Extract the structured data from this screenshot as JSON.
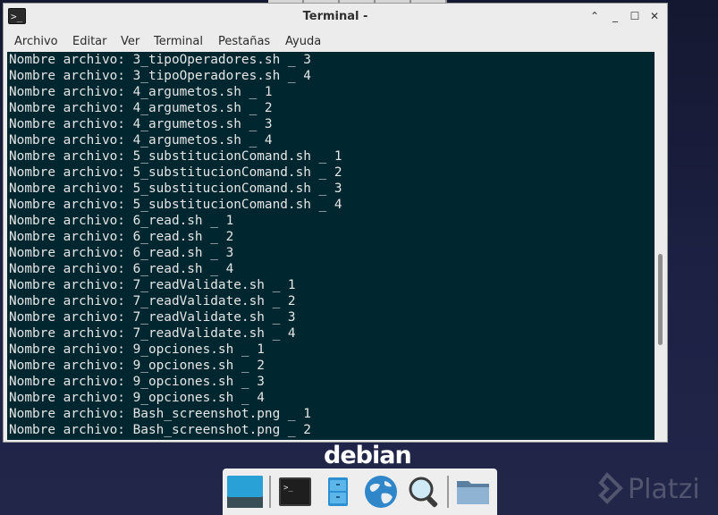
{
  "window": {
    "title": "Terminal -",
    "controls": {
      "up_glyph": "⌃",
      "minimize_glyph": "_",
      "maximize_glyph": "☐",
      "close_glyph": "✕"
    },
    "icon_glyph": ">_"
  },
  "menubar": {
    "items": [
      {
        "label": "Archivo"
      },
      {
        "label": "Editar"
      },
      {
        "label": "Ver"
      },
      {
        "label": "Terminal"
      },
      {
        "label": "Pestañas"
      },
      {
        "label": "Ayuda"
      }
    ]
  },
  "terminal": {
    "lines": [
      "Nombre archivo: 3_tipoOperadores.sh _ 3",
      "Nombre archivo: 3_tipoOperadores.sh _ 4",
      "Nombre archivo: 4_argumetos.sh _ 1",
      "Nombre archivo: 4_argumetos.sh _ 2",
      "Nombre archivo: 4_argumetos.sh _ 3",
      "Nombre archivo: 4_argumetos.sh _ 4",
      "Nombre archivo: 5_substitucionComand.sh _ 1",
      "Nombre archivo: 5_substitucionComand.sh _ 2",
      "Nombre archivo: 5_substitucionComand.sh _ 3",
      "Nombre archivo: 5_substitucionComand.sh _ 4",
      "Nombre archivo: 6_read.sh _ 1",
      "Nombre archivo: 6_read.sh _ 2",
      "Nombre archivo: 6_read.sh _ 3",
      "Nombre archivo: 6_read.sh _ 4",
      "Nombre archivo: 7_readValidate.sh _ 1",
      "Nombre archivo: 7_readValidate.sh _ 2",
      "Nombre archivo: 7_readValidate.sh _ 3",
      "Nombre archivo: 7_readValidate.sh _ 4",
      "Nombre archivo: 9_opciones.sh _ 1",
      "Nombre archivo: 9_opciones.sh _ 2",
      "Nombre archivo: 9_opciones.sh _ 3",
      "Nombre archivo: 9_opciones.sh _ 4",
      "Nombre archivo: Bash_screenshot.png _ 1",
      "Nombre archivo: Bash_screenshot.png _ 2"
    ],
    "background": "#00262f",
    "foreground": "#e6e6e6"
  },
  "desktop": {
    "logo_text": "debian",
    "watermark_text": "Platzi"
  },
  "dock": {
    "items": [
      {
        "icon": "show-desktop-icon"
      },
      {
        "icon": "terminal-icon"
      },
      {
        "icon": "file-manager-icon"
      },
      {
        "icon": "web-browser-icon"
      },
      {
        "icon": "app-finder-icon"
      },
      {
        "icon": "folder-icon"
      }
    ]
  }
}
